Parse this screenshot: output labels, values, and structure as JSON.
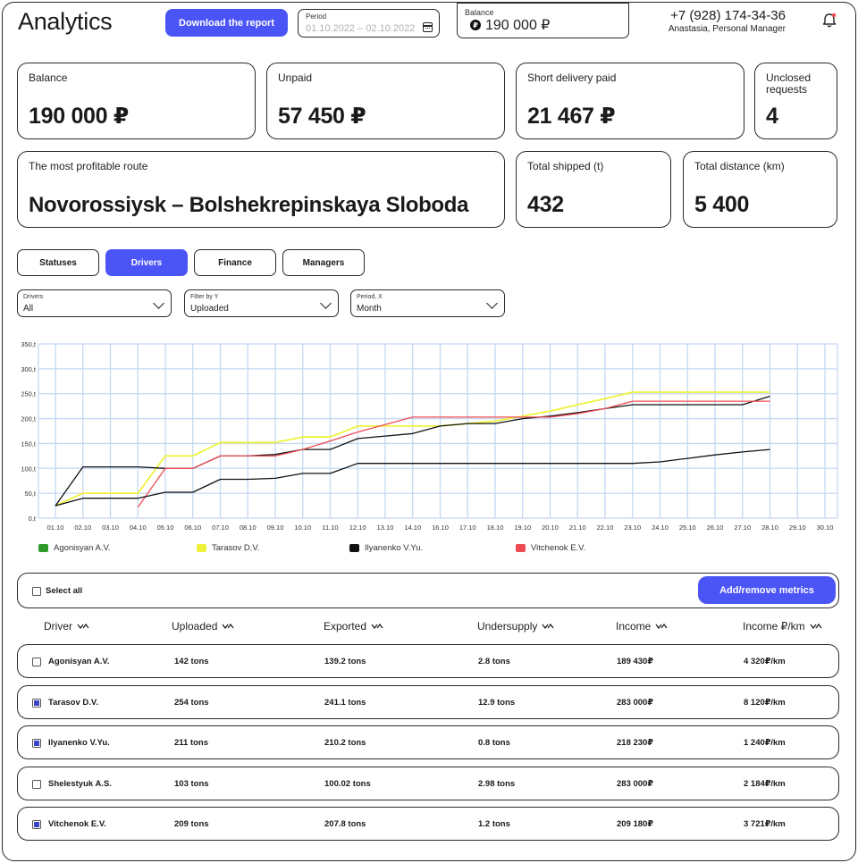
{
  "header": {
    "title": "Analytics",
    "download_label": "Download the report",
    "period_label": "Period",
    "period_value": "01.10.2022 – 02.10.2022",
    "balance_label": "Balance",
    "balance_value": "190 000 ₽",
    "phone": "+7 (928) 174-34-36",
    "manager": "Anastasia, Personal Manager"
  },
  "stats": {
    "balance": {
      "label": "Balance",
      "value": "190 000 ₽"
    },
    "unpaid": {
      "label": "Unpaid",
      "value": "57 450 ₽"
    },
    "short_paid": {
      "label": "Short delivery paid",
      "value": "21 467 ₽"
    },
    "unclosed": {
      "label": "Unclosed requests",
      "value": "4"
    },
    "route": {
      "label": "The most profitable route",
      "value": "Novorossiysk – Bolshekrepinskaya Sloboda"
    },
    "shipped": {
      "label": "Total shipped (t)",
      "value": "432"
    },
    "distance": {
      "label": "Total distance (km)",
      "value": "5 400"
    }
  },
  "tabs": [
    {
      "label": "Statuses",
      "active": false
    },
    {
      "label": "Drivers",
      "active": true
    },
    {
      "label": "Finance",
      "active": false
    },
    {
      "label": "Managers",
      "active": false
    }
  ],
  "filters": {
    "drivers": {
      "label": "Drivers",
      "value": "All"
    },
    "filter_y": {
      "label": "Filter by Y",
      "value": "Uploaded"
    },
    "period_x": {
      "label": "Period, X",
      "value": "Month"
    }
  },
  "chart_data": {
    "type": "line",
    "x": [
      "01.10",
      "02.10",
      "03.10",
      "04.10",
      "05.10",
      "06.10",
      "07.10",
      "08.10",
      "09.10",
      "10.10",
      "11.10",
      "12.10",
      "13.10",
      "14.10",
      "16.10",
      "17.10",
      "18.10",
      "19.10",
      "20.10",
      "21.10",
      "22.10",
      "23.10",
      "24.10",
      "25.10",
      "26.10",
      "27.10",
      "28.10",
      "29.10",
      "30.10"
    ],
    "yticks": [
      "0,t",
      "50,t",
      "100,t",
      "150,t",
      "200,t",
      "250,t",
      "300,t",
      "350,t"
    ],
    "ylim": [
      0,
      350
    ],
    "grid": true,
    "legend": "bottom",
    "series": [
      {
        "name": "Agonisyan A.V.",
        "color": "#2e9a2a",
        "values": []
      },
      {
        "name": "Tarasov D.V.",
        "color": "#eef23a",
        "points": [
          [
            0,
            25
          ],
          [
            1,
            50
          ],
          [
            2,
            50
          ],
          [
            3,
            50
          ],
          [
            4,
            125
          ],
          [
            5,
            125
          ],
          [
            6,
            152
          ],
          [
            7,
            152
          ],
          [
            8,
            152
          ],
          [
            9,
            163
          ],
          [
            10,
            163
          ],
          [
            11,
            185
          ],
          [
            12,
            185
          ],
          [
            13,
            185
          ],
          [
            14,
            185
          ],
          [
            15,
            190
          ],
          [
            16,
            195
          ],
          [
            17,
            205
          ],
          [
            18,
            215
          ],
          [
            19,
            228
          ],
          [
            20,
            240
          ],
          [
            21,
            253
          ],
          [
            22,
            253
          ],
          [
            23,
            253
          ],
          [
            24,
            253
          ],
          [
            25,
            253
          ],
          [
            26,
            253
          ]
        ]
      },
      {
        "name": "Ilyanenko V.Yu.",
        "color": "#111111",
        "points": [
          [
            0,
            25
          ],
          [
            1,
            103
          ],
          [
            2,
            103
          ],
          [
            3,
            103
          ],
          [
            4,
            100
          ],
          [
            5,
            100
          ],
          [
            6,
            125
          ],
          [
            7,
            125
          ],
          [
            8,
            128
          ],
          [
            9,
            138
          ],
          [
            10,
            138
          ],
          [
            11,
            160
          ],
          [
            12,
            165
          ],
          [
            13,
            170
          ],
          [
            14,
            185
          ],
          [
            15,
            190
          ],
          [
            16,
            190
          ],
          [
            17,
            200
          ],
          [
            18,
            205
          ],
          [
            19,
            212
          ],
          [
            20,
            220
          ],
          [
            21,
            228
          ],
          [
            22,
            228
          ],
          [
            23,
            228
          ],
          [
            24,
            228
          ],
          [
            25,
            228
          ],
          [
            26,
            245
          ]
        ]
      },
      {
        "name": "Vitchenok E.V.",
        "color": "#ee4b55",
        "points": [
          [
            3,
            22
          ],
          [
            4,
            100
          ],
          [
            5,
            100
          ],
          [
            6,
            125
          ],
          [
            7,
            125
          ],
          [
            8,
            125
          ],
          [
            9,
            138
          ],
          [
            10,
            155
          ],
          [
            11,
            173
          ],
          [
            12,
            188
          ],
          [
            13,
            203
          ],
          [
            14,
            203
          ],
          [
            15,
            203
          ],
          [
            16,
            203
          ],
          [
            17,
            203
          ],
          [
            18,
            203
          ],
          [
            19,
            210
          ],
          [
            20,
            220
          ],
          [
            21,
            235
          ],
          [
            22,
            235
          ],
          [
            23,
            235
          ],
          [
            24,
            235
          ],
          [
            25,
            235
          ],
          [
            26,
            235
          ]
        ]
      },
      {
        "name": "",
        "color": "#111111",
        "points": [
          [
            0,
            25
          ],
          [
            1,
            40
          ],
          [
            2,
            40
          ],
          [
            3,
            40
          ],
          [
            4,
            52
          ],
          [
            5,
            52
          ],
          [
            6,
            78
          ],
          [
            7,
            78
          ],
          [
            8,
            80
          ],
          [
            9,
            90
          ],
          [
            10,
            90
          ],
          [
            11,
            110
          ],
          [
            12,
            110
          ],
          [
            13,
            110
          ],
          [
            14,
            110
          ],
          [
            15,
            110
          ],
          [
            16,
            110
          ],
          [
            17,
            110
          ],
          [
            18,
            110
          ],
          [
            19,
            110
          ],
          [
            20,
            110
          ],
          [
            21,
            110
          ],
          [
            22,
            113
          ],
          [
            23,
            120
          ],
          [
            24,
            127
          ],
          [
            25,
            133
          ],
          [
            26,
            138
          ]
        ]
      }
    ]
  },
  "table": {
    "select_all": "Select all",
    "metrics_label": "Add/remove metrics",
    "headers": [
      "Driver",
      "Uploaded",
      "Exported",
      "Undersupply",
      "Income",
      "Income ₽/km"
    ],
    "rows": [
      {
        "checked": false,
        "cells": [
          "Agonisyan A.V.",
          "142 tons",
          "139.2 tons",
          "2.8 tons",
          "189 430₽",
          "4 320₽/km"
        ]
      },
      {
        "checked": true,
        "cells": [
          "Tarasov D.V.",
          "254 tons",
          "241.1 tons",
          "12.9 tons",
          "283 000₽",
          "8 120₽/km"
        ]
      },
      {
        "checked": true,
        "cells": [
          "Ilyanenko V.Yu.",
          "211 tons",
          "210.2 tons",
          "0.8 tons",
          "218 230₽",
          "1 240₽/km"
        ]
      },
      {
        "checked": false,
        "cells": [
          "Shelestyuk A.S.",
          "103 tons",
          "100.02 tons",
          "2.98 tons",
          "283 000₽",
          "2 184₽/km"
        ]
      },
      {
        "checked": true,
        "cells": [
          "Vitchenok E.V.",
          "209 tons",
          "207.8 tons",
          "1.2 tons",
          "209 180₽",
          "3 721₽/km"
        ]
      }
    ]
  }
}
